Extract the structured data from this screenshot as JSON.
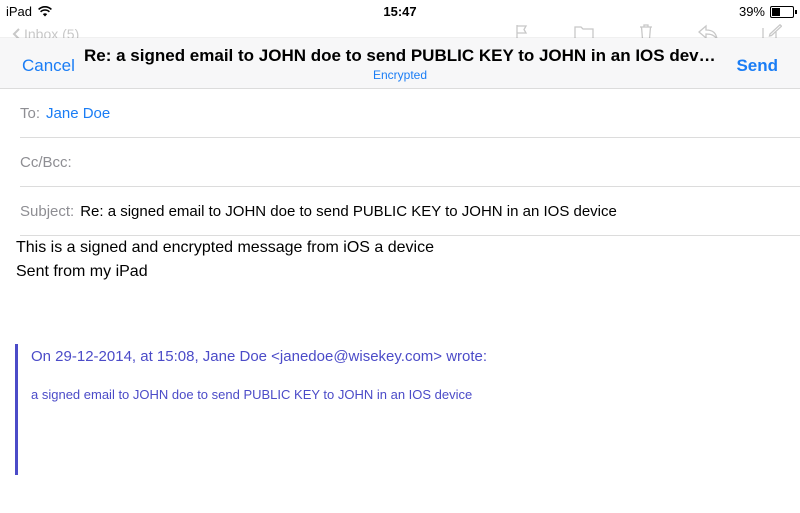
{
  "status_bar": {
    "device": "iPad",
    "time": "15:47",
    "battery": "39%",
    "battery_level": 0.39
  },
  "background_toolbar": {
    "back_label": "Inbox (5)",
    "icons": [
      "flag-icon",
      "folder-icon",
      "trash-icon",
      "reply-icon",
      "compose-icon"
    ]
  },
  "nav": {
    "cancel_label": "Cancel",
    "send_label": "Send",
    "title": "Re: a signed email to JOHN doe to send PUBLIC KEY to JOHN in an IOS device",
    "subtitle": "Encrypted"
  },
  "fields": {
    "to_label": "To:",
    "to_value": "Jane Doe",
    "ccbcc_label": "Cc/Bcc:",
    "subject_label": "Subject:",
    "subject_value": "Re: a signed email to JOHN doe to send PUBLIC KEY to JOHN in an IOS device"
  },
  "message": {
    "line1": "This is a signed and encrypted message from iOS a device",
    "line2": "Sent from my iPad"
  },
  "quote": {
    "header": "On 29-12-2014, at 15:08, Jane Doe <janedoe@wisekey.com> wrote:",
    "body": "a signed email to JOHN doe to send PUBLIC KEY to JOHN in an IOS device"
  },
  "colors": {
    "accent": "#1a7df5",
    "quote": "#4b4bc8"
  }
}
